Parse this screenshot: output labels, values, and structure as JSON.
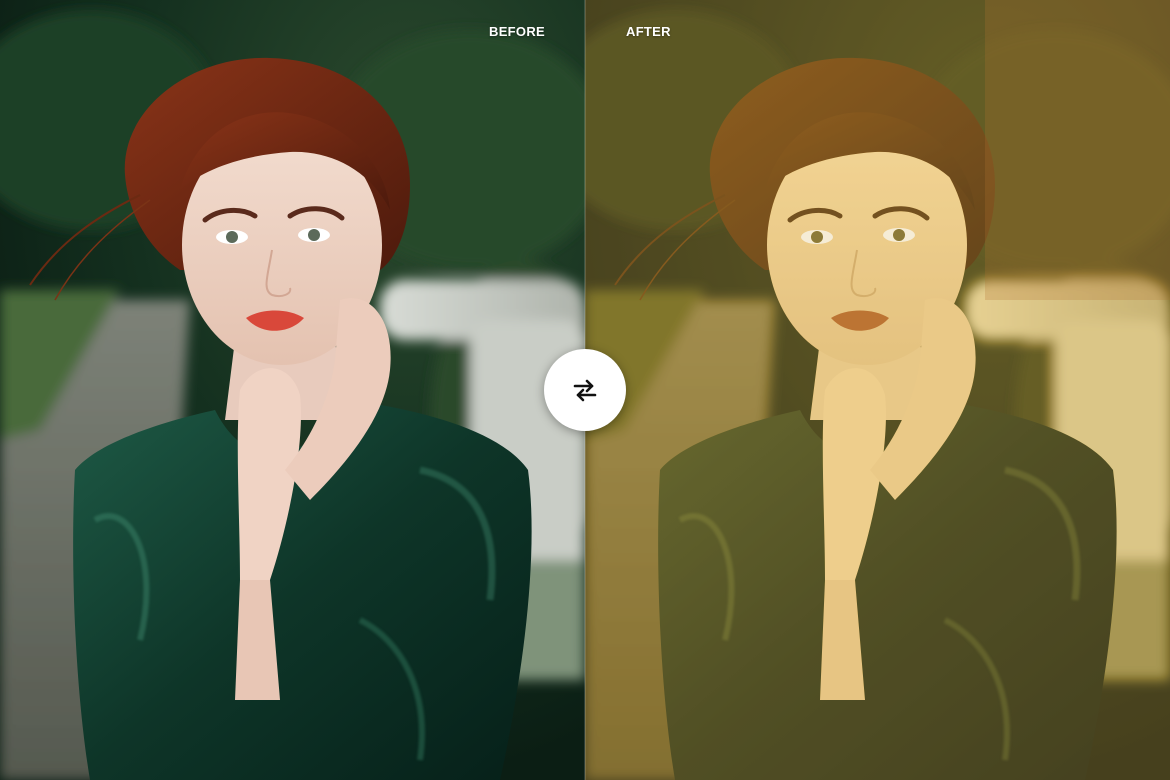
{
  "labels": {
    "before": "BEFORE",
    "after": "AFTER"
  },
  "compare_toggle": {
    "icon": "swap-arrows-icon"
  },
  "colors": {
    "before_background": "#16331f",
    "after_tint": "#c9a84b",
    "dress_green": "#0f3a2c",
    "hair_red": "#7a2a14",
    "lips": "#d9483a",
    "toggle_bg": "#ffffff"
  }
}
